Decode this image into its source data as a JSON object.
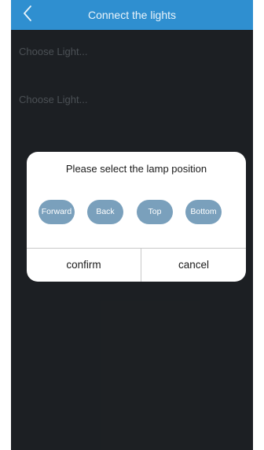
{
  "navbar": {
    "title": "Connect the lights",
    "back_icon": "chevron-left-icon",
    "color": "#2f8fd0"
  },
  "light_rows": [
    {
      "placeholder": "Choose Light..."
    },
    {
      "placeholder": "Choose Light..."
    }
  ],
  "dialog": {
    "title": "Please select the lamp position",
    "positions": [
      {
        "label": "Forward"
      },
      {
        "label": "Back"
      },
      {
        "label": "Top"
      },
      {
        "label": "Bottom"
      }
    ],
    "confirm_label": "confirm",
    "cancel_label": "cancel",
    "position_button_color": "#7aa0bc"
  }
}
